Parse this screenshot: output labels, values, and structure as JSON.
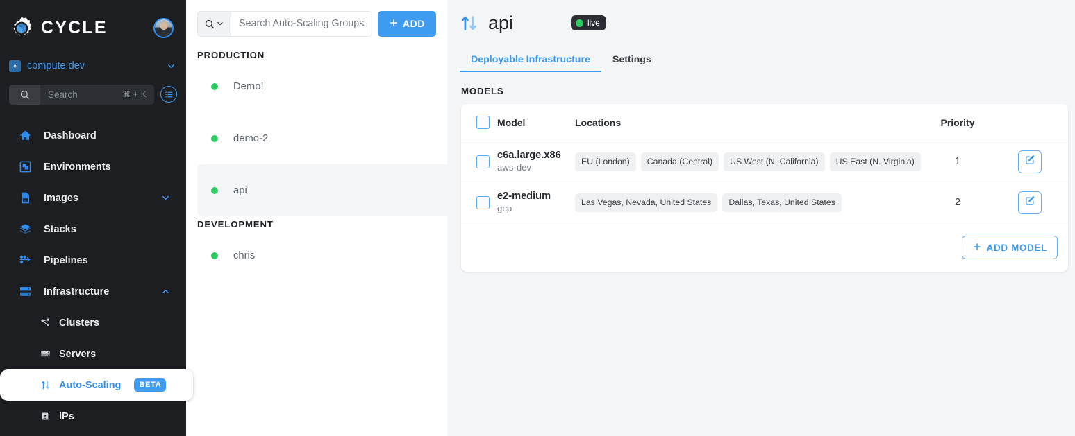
{
  "brand": {
    "name": "CYCLE",
    "logo_icon": "cycle-gear-cube-logo",
    "accent": "#3e9bf0"
  },
  "sidebar": {
    "cluster": {
      "label": "compute dev",
      "icon": "cluster-gear-icon",
      "caret_icon": "chevron-down-icon"
    },
    "search": {
      "placeholder": "Search",
      "shortcut": "⌘ + K",
      "icon": "search-icon"
    },
    "list_button_icon": "list-checklist-icon",
    "nav": [
      {
        "label": "Dashboard",
        "icon": "home-icon",
        "caret": ""
      },
      {
        "label": "Environments",
        "icon": "environments-icon",
        "caret": ""
      },
      {
        "label": "Images",
        "icon": "image-file-icon",
        "caret": "chevron-down-icon"
      },
      {
        "label": "Stacks",
        "icon": "layers-icon",
        "caret": ""
      },
      {
        "label": "Pipelines",
        "icon": "pipelines-icon",
        "caret": ""
      },
      {
        "label": "Infrastructure",
        "icon": "server-rack-icon",
        "caret": "chevron-up-icon"
      }
    ],
    "sub_nav": [
      {
        "label": "Clusters",
        "icon": "network-nodes-icon",
        "active": false,
        "badge": ""
      },
      {
        "label": "Servers",
        "icon": "server-icon",
        "active": false,
        "badge": ""
      },
      {
        "label": "Auto-Scaling",
        "icon": "up-down-arrows-icon",
        "active": true,
        "badge": "BETA"
      },
      {
        "label": "IPs",
        "icon": "ip-address-icon",
        "active": false,
        "badge": ""
      }
    ]
  },
  "list_panel": {
    "search": {
      "placeholder": "Search Auto-Scaling Groups",
      "icon": "search-icon",
      "caret_icon": "chevron-down-icon"
    },
    "add_button": {
      "label": "ADD",
      "icon": "plus-icon"
    },
    "groups": [
      {
        "label": "PRODUCTION",
        "items": [
          {
            "name": "Demo!",
            "status_color": "#2ecc63",
            "selected": false
          },
          {
            "name": "demo-2",
            "status_color": "#2ecc63",
            "selected": false
          },
          {
            "name": "api",
            "status_color": "#2ecc63",
            "selected": true
          }
        ]
      },
      {
        "label": "DEVELOPMENT",
        "items": [
          {
            "name": "chris",
            "status_color": "#2ecc63",
            "selected": false
          }
        ]
      }
    ]
  },
  "main": {
    "title": "api",
    "title_icon": "up-down-arrows-icon",
    "status_badge": {
      "label": "live",
      "dot_color": "#2ecc63"
    },
    "tabs": [
      {
        "label": "Deployable Infrastructure",
        "active": true
      },
      {
        "label": "Settings",
        "active": false
      }
    ],
    "section_label": "MODELS",
    "table": {
      "select_all_checkbox": "select-all",
      "columns": [
        "Model",
        "Locations",
        "Priority"
      ],
      "rows": [
        {
          "model": "c6a.large.x86",
          "provider": "aws-dev",
          "locations": [
            "EU (London)",
            "Canada (Central)",
            "US West (N. California)",
            "US East (N. Virginia)"
          ],
          "priority": "1",
          "edit_icon": "edit-pencil-icon",
          "checked": false
        },
        {
          "model": "e2-medium",
          "provider": "gcp",
          "locations": [
            "Las Vegas, Nevada, United States",
            "Dallas, Texas, United States"
          ],
          "priority": "2",
          "edit_icon": "edit-pencil-icon",
          "checked": false
        }
      ]
    },
    "add_model_button": {
      "label": "ADD MODEL",
      "icon": "plus-icon"
    }
  }
}
